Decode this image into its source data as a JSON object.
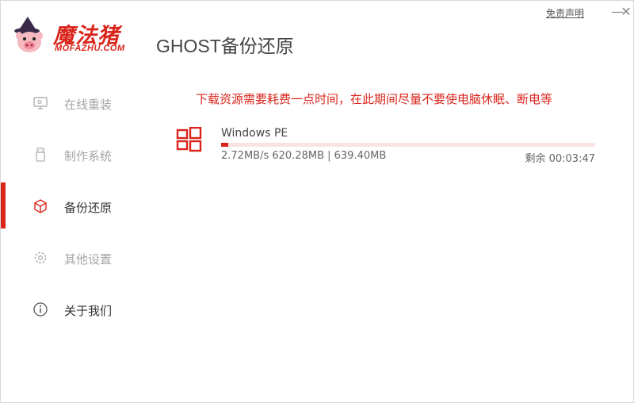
{
  "app": {
    "logo_cn": "魔法猪",
    "logo_en": "MOFAZHU.COM",
    "title": "GHOST备份还原"
  },
  "topbar": {
    "disclaimer": "免责声明",
    "minimize_glyph": "—",
    "close_glyph": "✕"
  },
  "sidebar": {
    "items": [
      {
        "label": "在线重装",
        "icon": "monitor-icon"
      },
      {
        "label": "制作系统",
        "icon": "usb-icon"
      },
      {
        "label": "备份还原",
        "icon": "cube-icon",
        "active": true
      },
      {
        "label": "其他设置",
        "icon": "gear-icon"
      },
      {
        "label": "关于我们",
        "icon": "info-icon"
      }
    ]
  },
  "main": {
    "notice": "下载资源需要耗费一点时间，在此期间尽量不要使电脑休眠、断电等",
    "download": {
      "name": "Windows PE",
      "stats": "2.72MB/s 620.28MB | 639.40MB",
      "remaining": "剩余 00:03:47",
      "progress_fraction": 0.02
    }
  },
  "colors": {
    "accent": "#d9251c",
    "progress_track": "#fbe3e2",
    "inactive_text": "#a5a5a5"
  }
}
